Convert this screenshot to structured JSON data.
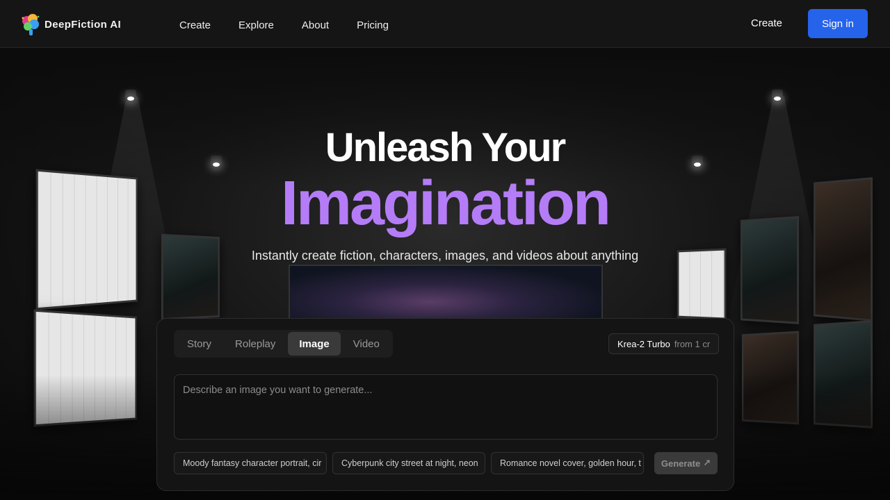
{
  "brand": {
    "name": "DeepFiction AI"
  },
  "nav": {
    "links": [
      "Create",
      "Explore",
      "About",
      "Pricing"
    ],
    "create_label": "Create",
    "signin_label": "Sign in"
  },
  "hero": {
    "title_line1": "Unleash Your",
    "title_line2": "Imagination",
    "subtitle": "Instantly create fiction, characters, images, and videos about anything"
  },
  "composer": {
    "tabs": [
      {
        "label": "Story",
        "active": false
      },
      {
        "label": "Roleplay",
        "active": false
      },
      {
        "label": "Image",
        "active": true
      },
      {
        "label": "Video",
        "active": false
      }
    ],
    "model": {
      "name": "Krea-2 Turbo",
      "cost": "from 1 cr"
    },
    "prompt": {
      "placeholder": "Describe an image you want to generate...",
      "value": ""
    },
    "suggestions": [
      "Moody fantasy character portrait, cir",
      "Cyberpunk city street at night, neon",
      "Romance novel cover, golden hour, t"
    ],
    "generate_label": "Generate",
    "generate_icon": "arrow-up-right-icon"
  },
  "colors": {
    "accent_purple": "#b57cf7",
    "signin_blue": "#2563eb",
    "nav_bg": "#151515",
    "panel_bg": "#141414"
  }
}
